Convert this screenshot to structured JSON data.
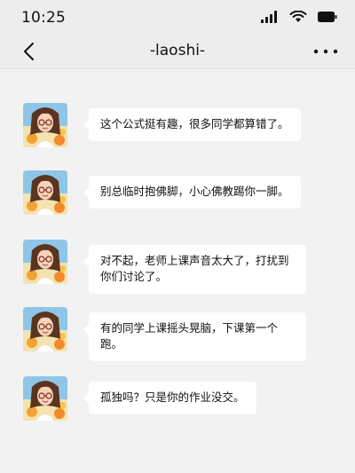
{
  "status": {
    "time": "10:25"
  },
  "nav": {
    "title": "-laoshi-"
  },
  "icons": {
    "signal": "signal-icon",
    "wifi": "wifi-icon",
    "battery": "battery-icon",
    "back": "chevron-left-icon",
    "more": "more-horizontal-icon",
    "avatar": "teacher-avatar"
  },
  "colors": {
    "background": "#f2f2f2",
    "bar": "#ededed",
    "bubble": "#ffffff"
  },
  "messages": [
    {
      "text": "这个公式挺有趣，很多同学都算错了。"
    },
    {
      "text": "别总临时抱佛脚，小心佛教踢你一脚。"
    },
    {
      "text": "对不起，老师上课声音太大了，打扰到你们讨论了。"
    },
    {
      "text": "有的同学上课摇头晃脑，下课第一个跑。"
    },
    {
      "text": "孤独吗？只是你的作业没交。"
    }
  ]
}
